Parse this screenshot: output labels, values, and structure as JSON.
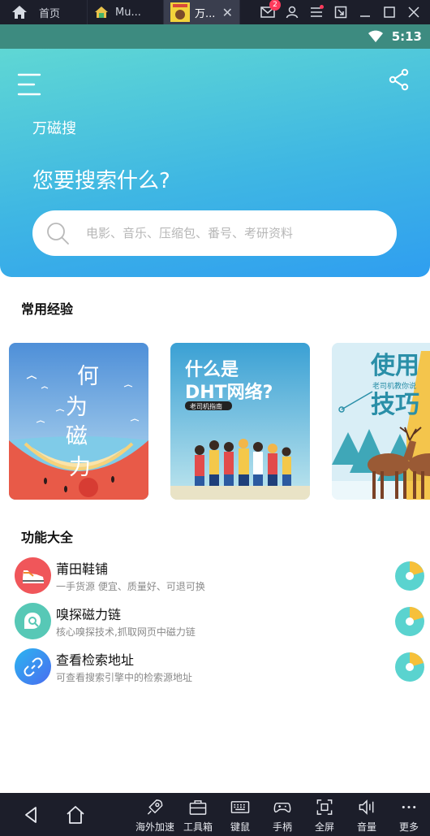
{
  "emulator": {
    "tabs": [
      {
        "label": "首页",
        "icon": "home-icon"
      },
      {
        "label": "Mu...",
        "icon": "app-icon"
      },
      {
        "label": "万...",
        "icon": "app-icon"
      }
    ],
    "notification_count": "2",
    "toolbar": [
      {
        "label": "海外加速",
        "icon": "rocket-icon"
      },
      {
        "label": "工具箱",
        "icon": "toolbox-icon"
      },
      {
        "label": "键鼠",
        "icon": "keyboard-icon"
      },
      {
        "label": "手柄",
        "icon": "gamepad-icon"
      },
      {
        "label": "全屏",
        "icon": "fullscreen-icon"
      },
      {
        "label": "音量",
        "icon": "volume-icon"
      },
      {
        "label": "更多",
        "icon": "more-icon"
      }
    ]
  },
  "status_bar": {
    "time": "5:13"
  },
  "header": {
    "app_name": "万磁搜",
    "headline": "您要搜索什么?",
    "search_placeholder": "电影、音乐、压缩包、番号、考研资料"
  },
  "experience": {
    "title": "常用经验",
    "cards": [
      {
        "lines": [
          "何",
          "为",
          "磁",
          "力"
        ]
      },
      {
        "line1": "什么是",
        "line2": "DHT网络?",
        "tag": "老司机指南"
      },
      {
        "line1": "使用",
        "line2": "技巧",
        "sub": "老司机教你说"
      }
    ]
  },
  "functions": {
    "title": "功能大全",
    "items": [
      {
        "title": "莆田鞋铺",
        "desc": "一手货源 便宜、质量好、可退可换",
        "icon": "sneaker-icon",
        "color": "#f0565a"
      },
      {
        "title": "嗅探磁力链",
        "desc": "核心嗅探技术,抓取网页中磁力链",
        "icon": "sniff-icon",
        "color": "#57c8b6"
      },
      {
        "title": "查看检索地址",
        "desc": "可查看搜索引擎中的检索源地址",
        "icon": "link-icon",
        "color": "#3f8af0"
      }
    ]
  },
  "colors": {
    "accent": "#3fb7e3",
    "teal": "#5fd7d4",
    "status": "#3d8b80"
  }
}
